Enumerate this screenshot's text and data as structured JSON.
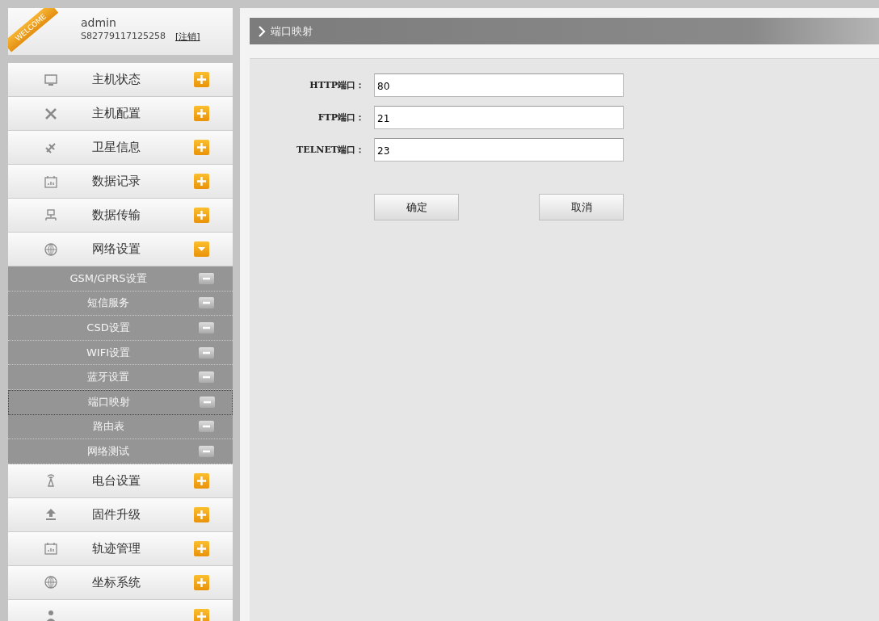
{
  "user": {
    "badge": "WELCOME",
    "name": "admin",
    "serial": "S82779117125258",
    "logout": "[注销]"
  },
  "menu": [
    {
      "label": "主机状态",
      "expanded": false
    },
    {
      "label": "主机配置",
      "expanded": false
    },
    {
      "label": "卫星信息",
      "expanded": false
    },
    {
      "label": "数据记录",
      "expanded": false
    },
    {
      "label": "数据传输",
      "expanded": false
    },
    {
      "label": "网络设置",
      "expanded": true,
      "children": [
        {
          "label": "GSM/GPRS设置",
          "selected": false
        },
        {
          "label": "短信服务",
          "selected": false
        },
        {
          "label": "CSD设置",
          "selected": false
        },
        {
          "label": "WIFI设置",
          "selected": false
        },
        {
          "label": "蓝牙设置",
          "selected": false
        },
        {
          "label": "端口映射",
          "selected": true
        },
        {
          "label": "路由表",
          "selected": false
        },
        {
          "label": "网络测试",
          "selected": false
        }
      ]
    },
    {
      "label": "电台设置",
      "expanded": false
    },
    {
      "label": "固件升级",
      "expanded": false
    },
    {
      "label": "轨迹管理",
      "expanded": false
    },
    {
      "label": "坐标系统",
      "expanded": false
    },
    {
      "expanded": false
    }
  ],
  "page_title": "端口映射",
  "fields": [
    {
      "label": "HTTP端口：",
      "value": "80"
    },
    {
      "label": "FTP端口：",
      "value": "21"
    },
    {
      "label": "TELNET端口：",
      "value": "23"
    }
  ],
  "buttons": [
    "确定",
    "取消"
  ]
}
